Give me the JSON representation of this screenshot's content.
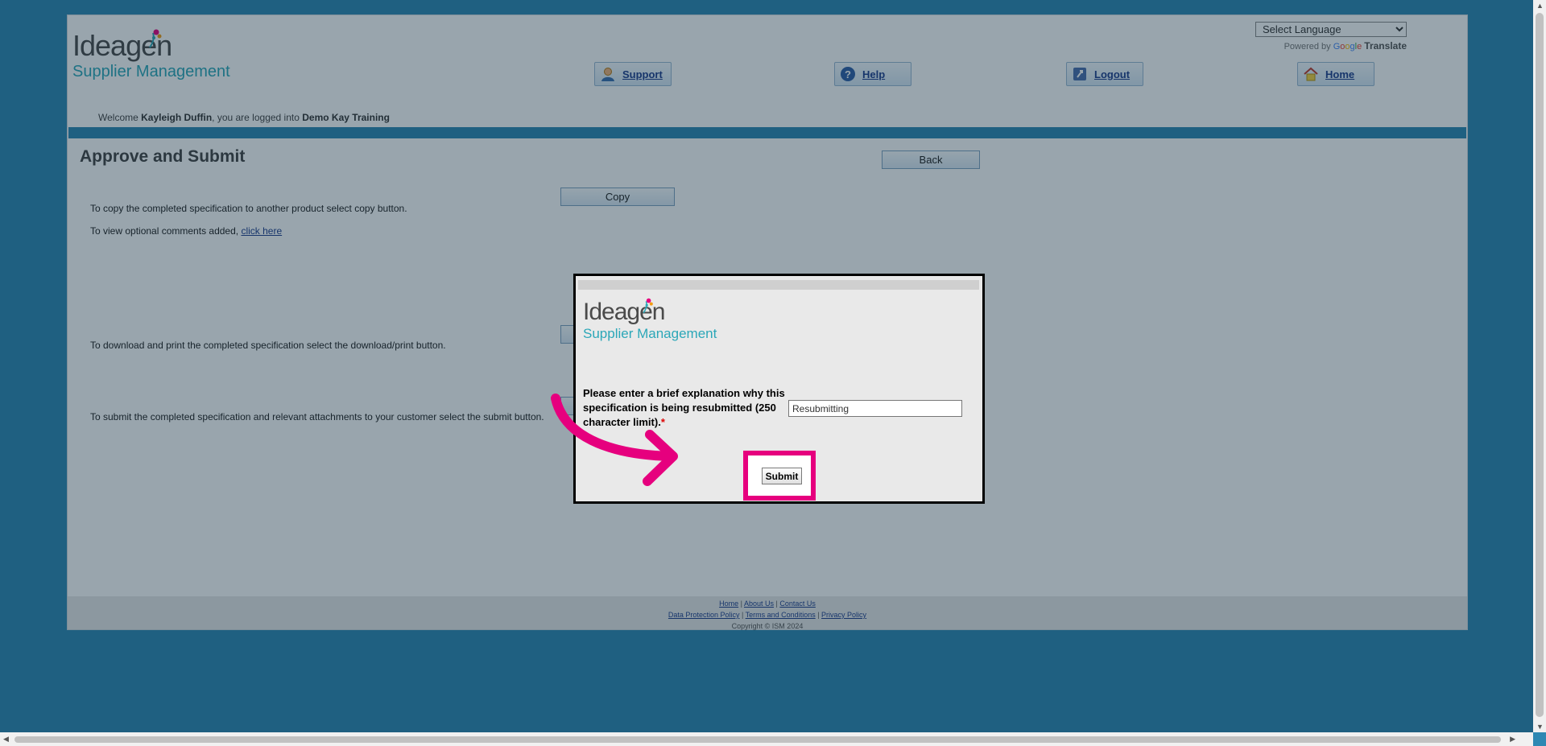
{
  "brand": {
    "wordmark": "Ideagen",
    "product": "Supplier Management"
  },
  "language": {
    "select_label": "Select Language",
    "powered_by": "Powered by",
    "google": "Google",
    "translate": "Translate"
  },
  "nav": [
    {
      "label": "Support",
      "icon": "user-support-icon"
    },
    {
      "label": "Help",
      "icon": "help-icon"
    },
    {
      "label": "Logout",
      "icon": "logout-icon"
    },
    {
      "label": "Home",
      "icon": "home-icon"
    }
  ],
  "welcome": {
    "prefix": "Welcome",
    "user": "Kayleigh Duffin",
    "middle": ", you are logged into",
    "org": "Demo Kay Training"
  },
  "page": {
    "title": "Approve and Submit",
    "back_label": "Back",
    "copy_text": "To copy the completed specification to another product select copy button.",
    "copy_label": "Copy",
    "comments_text": "To view optional comments added,",
    "comments_link": "click here",
    "download_text": "To download and print the completed specification select the download/print button.",
    "submit_text": "To submit the completed specification and relevant attachments to your customer select the submit button."
  },
  "footer": {
    "row1": [
      "Home",
      "About Us",
      "Contact Us"
    ],
    "row2": [
      "Data Protection Policy",
      "Terms and Conditions",
      "Privacy Policy"
    ],
    "copyright": "Copyright © ISM 2024"
  },
  "modal": {
    "label": "Please enter a brief explanation why this specification is being resubmitted (250 character limit).",
    "required_mark": "*",
    "input_value": "Resubmitting",
    "submit_label": "Submit"
  },
  "colors": {
    "page_bg": "#2e88b3",
    "brand_teal": "#2ba7b8",
    "highlight": "#e6007e",
    "link": "#1f3f8e"
  }
}
